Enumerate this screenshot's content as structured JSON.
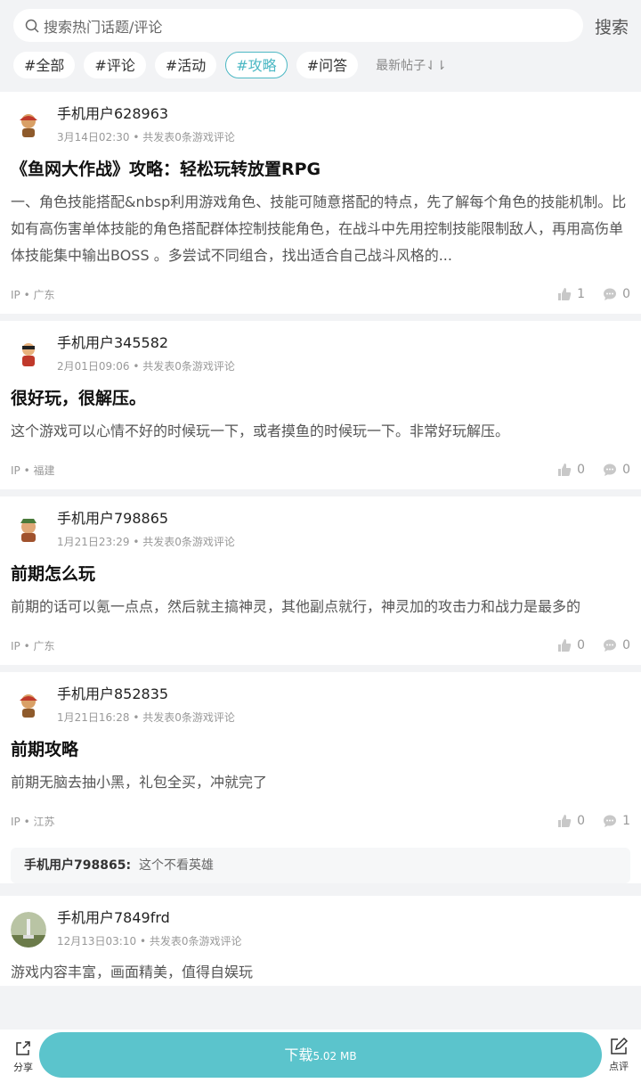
{
  "search": {
    "placeholder": "搜索热门话题/评论",
    "button": "搜索"
  },
  "tags": [
    {
      "label": "#全部",
      "active": false
    },
    {
      "label": "#评论",
      "active": false
    },
    {
      "label": "#活动",
      "active": false
    },
    {
      "label": "#攻略",
      "active": true
    },
    {
      "label": "#问答",
      "active": false
    }
  ],
  "sort_label": "最新帖子⇃⇂",
  "posts": [
    {
      "user": "手机用户628963",
      "time": "3月14日02:30",
      "meta_suffix": "共发表0条游戏评论",
      "title": "《鱼网大作战》攻略：轻松玩转放置RPG",
      "body": "一、角色技能搭配&nbsp利用游戏角色、技能可随意搭配的特点，先了解每个角色的技能机制。比如有高伤害单体技能的角色搭配群体控制技能角色，在战斗中先用控制技能限制敌人，再用高伤单体技能集中输出BOSS 。多尝试不同组合，找出适合自己战斗风格的...",
      "ip": "IP • 广东",
      "likes": "1",
      "comments": "0"
    },
    {
      "user": "手机用户345582",
      "time": "2月01日09:06",
      "meta_suffix": "共发表0条游戏评论",
      "title": "很好玩，很解压。",
      "body": "这个游戏可以心情不好的时候玩一下，或者摸鱼的时候玩一下。非常好玩解压。",
      "ip": "IP • 福建",
      "likes": "0",
      "comments": "0"
    },
    {
      "user": "手机用户798865",
      "time": "1月21日23:29",
      "meta_suffix": "共发表0条游戏评论",
      "title": "前期怎么玩",
      "body": "前期的话可以氪一点点，然后就主搞神灵，其他副点就行，神灵加的攻击力和战力是最多的",
      "ip": "IP • 广东",
      "likes": "0",
      "comments": "0"
    },
    {
      "user": "手机用户852835",
      "time": "1月21日16:28",
      "meta_suffix": "共发表0条游戏评论",
      "title": "前期攻略",
      "body": "前期无脑去抽小黑，礼包全买，冲就完了",
      "ip": "IP • 江苏",
      "likes": "0",
      "comments": "1",
      "reply_user": "手机用户798865:",
      "reply_text": "这个不看英雄"
    },
    {
      "user": "手机用户7849frd",
      "time": "12月13日03:10",
      "meta_suffix": "共发表0条游戏评论",
      "body": "游戏内容丰富，画面精美，值得自娱玩"
    }
  ],
  "bottom": {
    "share": "分享",
    "download": "下载",
    "size": "5.02 MB",
    "review": "点评"
  },
  "colors": {
    "accent": "#4cb8c4",
    "download_bg": "#5bc4cc"
  }
}
